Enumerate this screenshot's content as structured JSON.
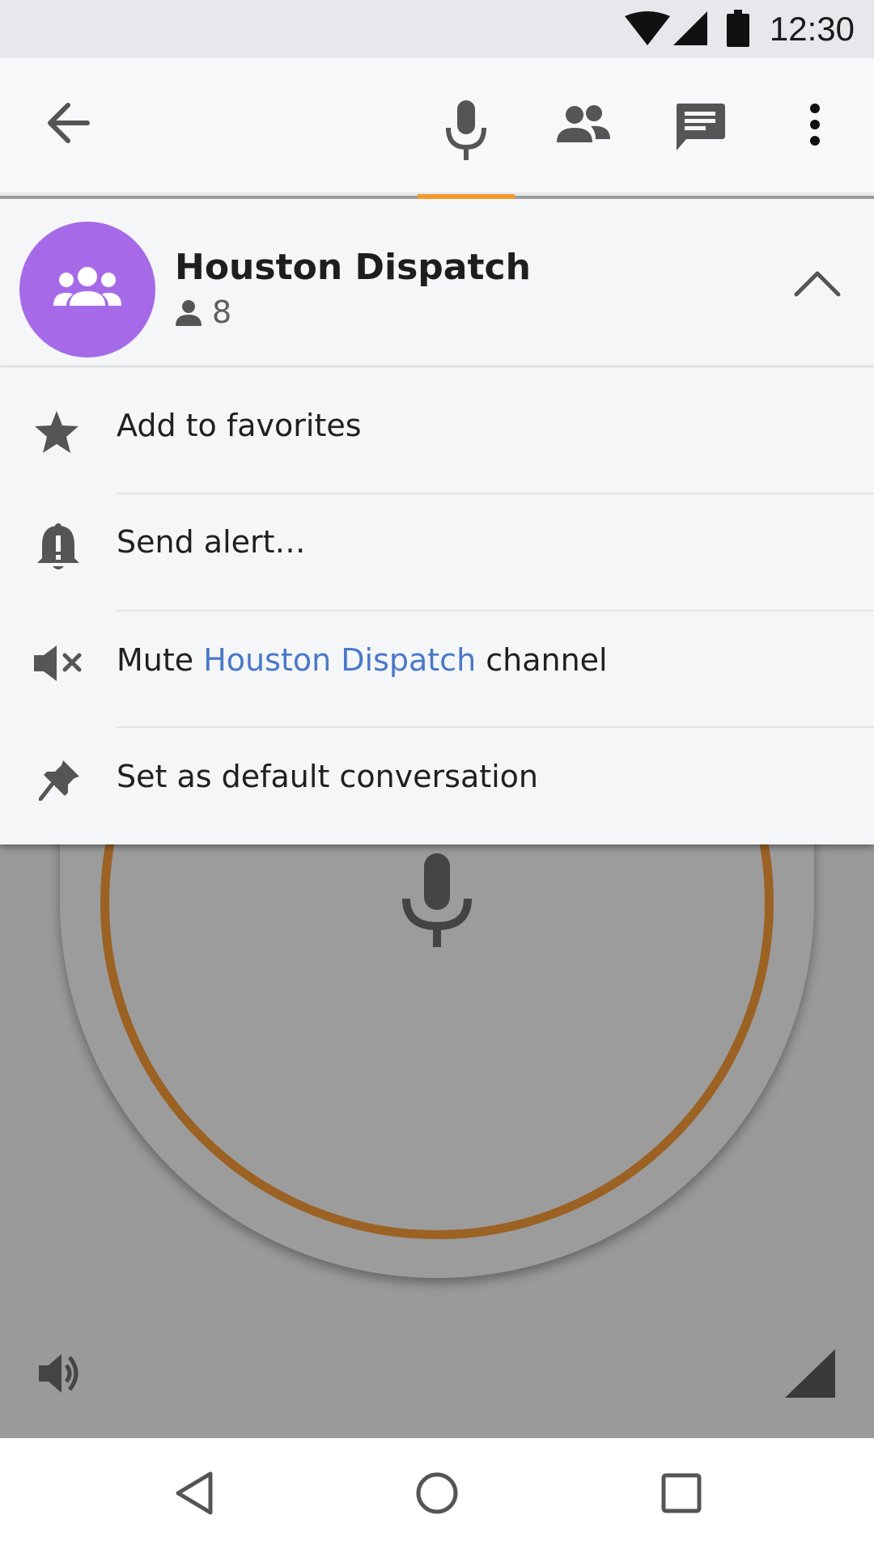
{
  "status_bar": {
    "time": "12:30",
    "icons": [
      "wifi-icon",
      "cell-signal-icon",
      "battery-icon"
    ]
  },
  "app_bar": {
    "actions": [
      "back-arrow-icon",
      "microphone-icon",
      "people-icon",
      "message-icon",
      "more-vert-icon"
    ],
    "active_tab": "microphone",
    "accent_color": "#f39a2c"
  },
  "channel": {
    "name": "Houston Dispatch",
    "member_count": "8",
    "avatar_color": "#a66ae8",
    "avatar_icon": "group-icon"
  },
  "menu": {
    "favorites_label": "Add to favorites",
    "alert_label": "Send alert…",
    "mute_prefix": "Mute ",
    "mute_channel": "Houston Dispatch",
    "mute_suffix": " channel",
    "default_label": "Set as default conversation",
    "link_color": "#4a78c8"
  },
  "ptt": {
    "ring_color": "#9b6224",
    "icon": "microphone-icon"
  },
  "bottom_controls": {
    "volume_icon": "volume-up-icon",
    "signal_icon": "signal-icon"
  },
  "nav_bar": {
    "icons": [
      "nav-back-icon",
      "nav-home-icon",
      "nav-recents-icon"
    ]
  }
}
